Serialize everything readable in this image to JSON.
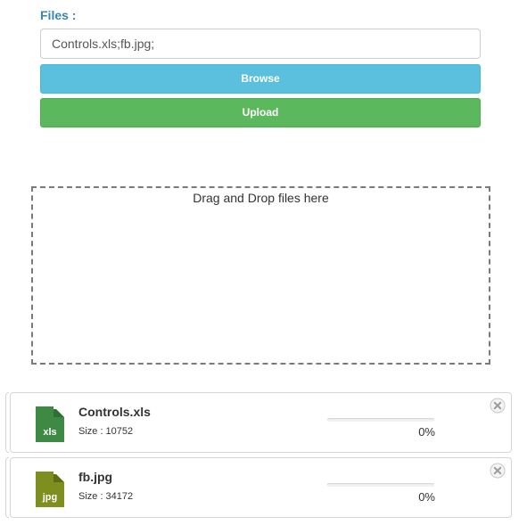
{
  "form": {
    "files_label": "Files :",
    "files_input_value": "Controls.xls;fb.jpg;",
    "browse_label": "Browse",
    "upload_label": "Upload"
  },
  "dropzone": {
    "text": "Drag and Drop files here"
  },
  "files": [
    {
      "name": "Controls.xls",
      "extension": "xls",
      "size_label": "Size :",
      "size": "10752",
      "progress_percent": 0,
      "progress_text": "0%",
      "icon": "excel-file-icon",
      "icon_color": "#3e8a45"
    },
    {
      "name": "fb.jpg",
      "extension": "jpg",
      "size_label": "Size :",
      "size": "34172",
      "progress_percent": 0,
      "progress_text": "0%",
      "icon": "image-file-icon",
      "icon_color": "#7e8f1f"
    }
  ],
  "colors": {
    "label_blue": "#3a87ad",
    "browse": "#5bc0de",
    "upload": "#5cb85c"
  }
}
